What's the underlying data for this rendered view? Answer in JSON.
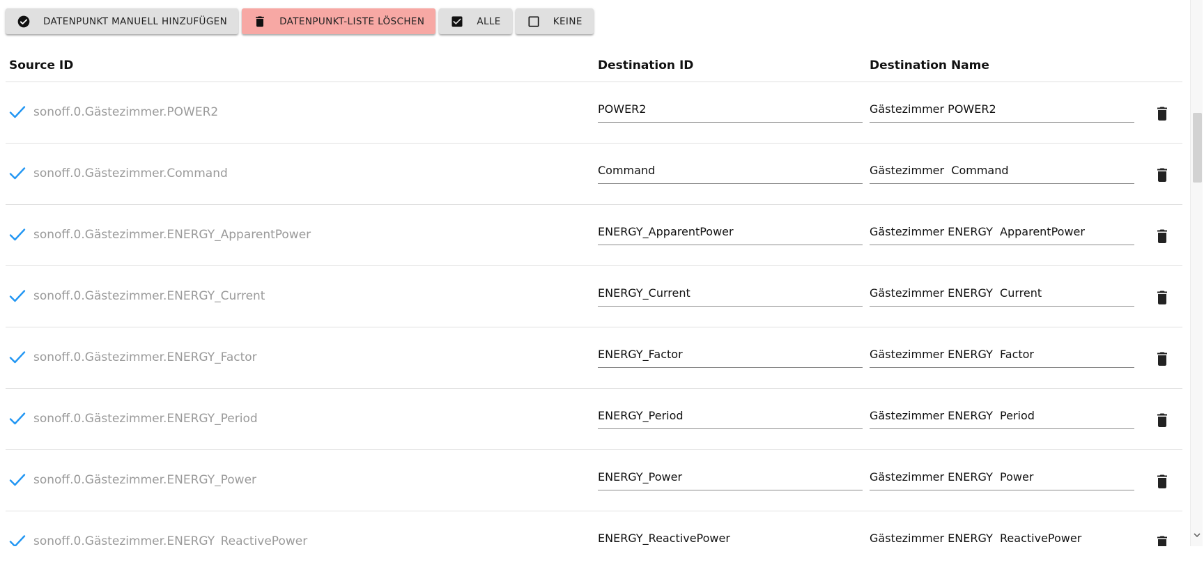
{
  "toolbar": {
    "buttons": [
      {
        "label": "DATENPUNKT MANUELL HINZUFÜGEN",
        "icon": "check-circle-icon"
      },
      {
        "label": "DATENPUNKT-LISTE LÖSCHEN",
        "icon": "trash-icon",
        "color": "#f7a8a4"
      },
      {
        "label": "ALLE",
        "icon": "checkbox-checked-icon"
      },
      {
        "label": "KEINE",
        "icon": "checkbox-empty-icon"
      }
    ]
  },
  "table": {
    "headers": {
      "source": "Source ID",
      "dest_id": "Destination ID",
      "dest_name": "Destination Name"
    },
    "rows": [
      {
        "source": "sonoff.0.Gästezimmer.POWER2",
        "dest_id": "POWER2",
        "dest_name": "Gästezimmer POWER2"
      },
      {
        "source": "sonoff.0.Gästezimmer.Command",
        "dest_id": "Command",
        "dest_name": "Gästezimmer  Command"
      },
      {
        "source": "sonoff.0.Gästezimmer.ENERGY_ApparentPower",
        "dest_id": "ENERGY_ApparentPower",
        "dest_name": "Gästezimmer ENERGY  ApparentPower"
      },
      {
        "source": "sonoff.0.Gästezimmer.ENERGY_Current",
        "dest_id": "ENERGY_Current",
        "dest_name": "Gästezimmer ENERGY  Current"
      },
      {
        "source": "sonoff.0.Gästezimmer.ENERGY_Factor",
        "dest_id": "ENERGY_Factor",
        "dest_name": "Gästezimmer ENERGY  Factor"
      },
      {
        "source": "sonoff.0.Gästezimmer.ENERGY_Period",
        "dest_id": "ENERGY_Period",
        "dest_name": "Gästezimmer ENERGY  Period"
      },
      {
        "source": "sonoff.0.Gästezimmer.ENERGY_Power",
        "dest_id": "ENERGY_Power",
        "dest_name": "Gästezimmer ENERGY  Power"
      },
      {
        "source": "sonoff.0.Gästezimmer.ENERGY_ReactivePower",
        "dest_id": "ENERGY_ReactivePower",
        "dest_name": "Gästezimmer ENERGY  ReactivePower"
      }
    ]
  },
  "colors": {
    "check": "#2196f3",
    "danger_button": "#f7a8a4",
    "source_text": "#9a9a9a"
  }
}
